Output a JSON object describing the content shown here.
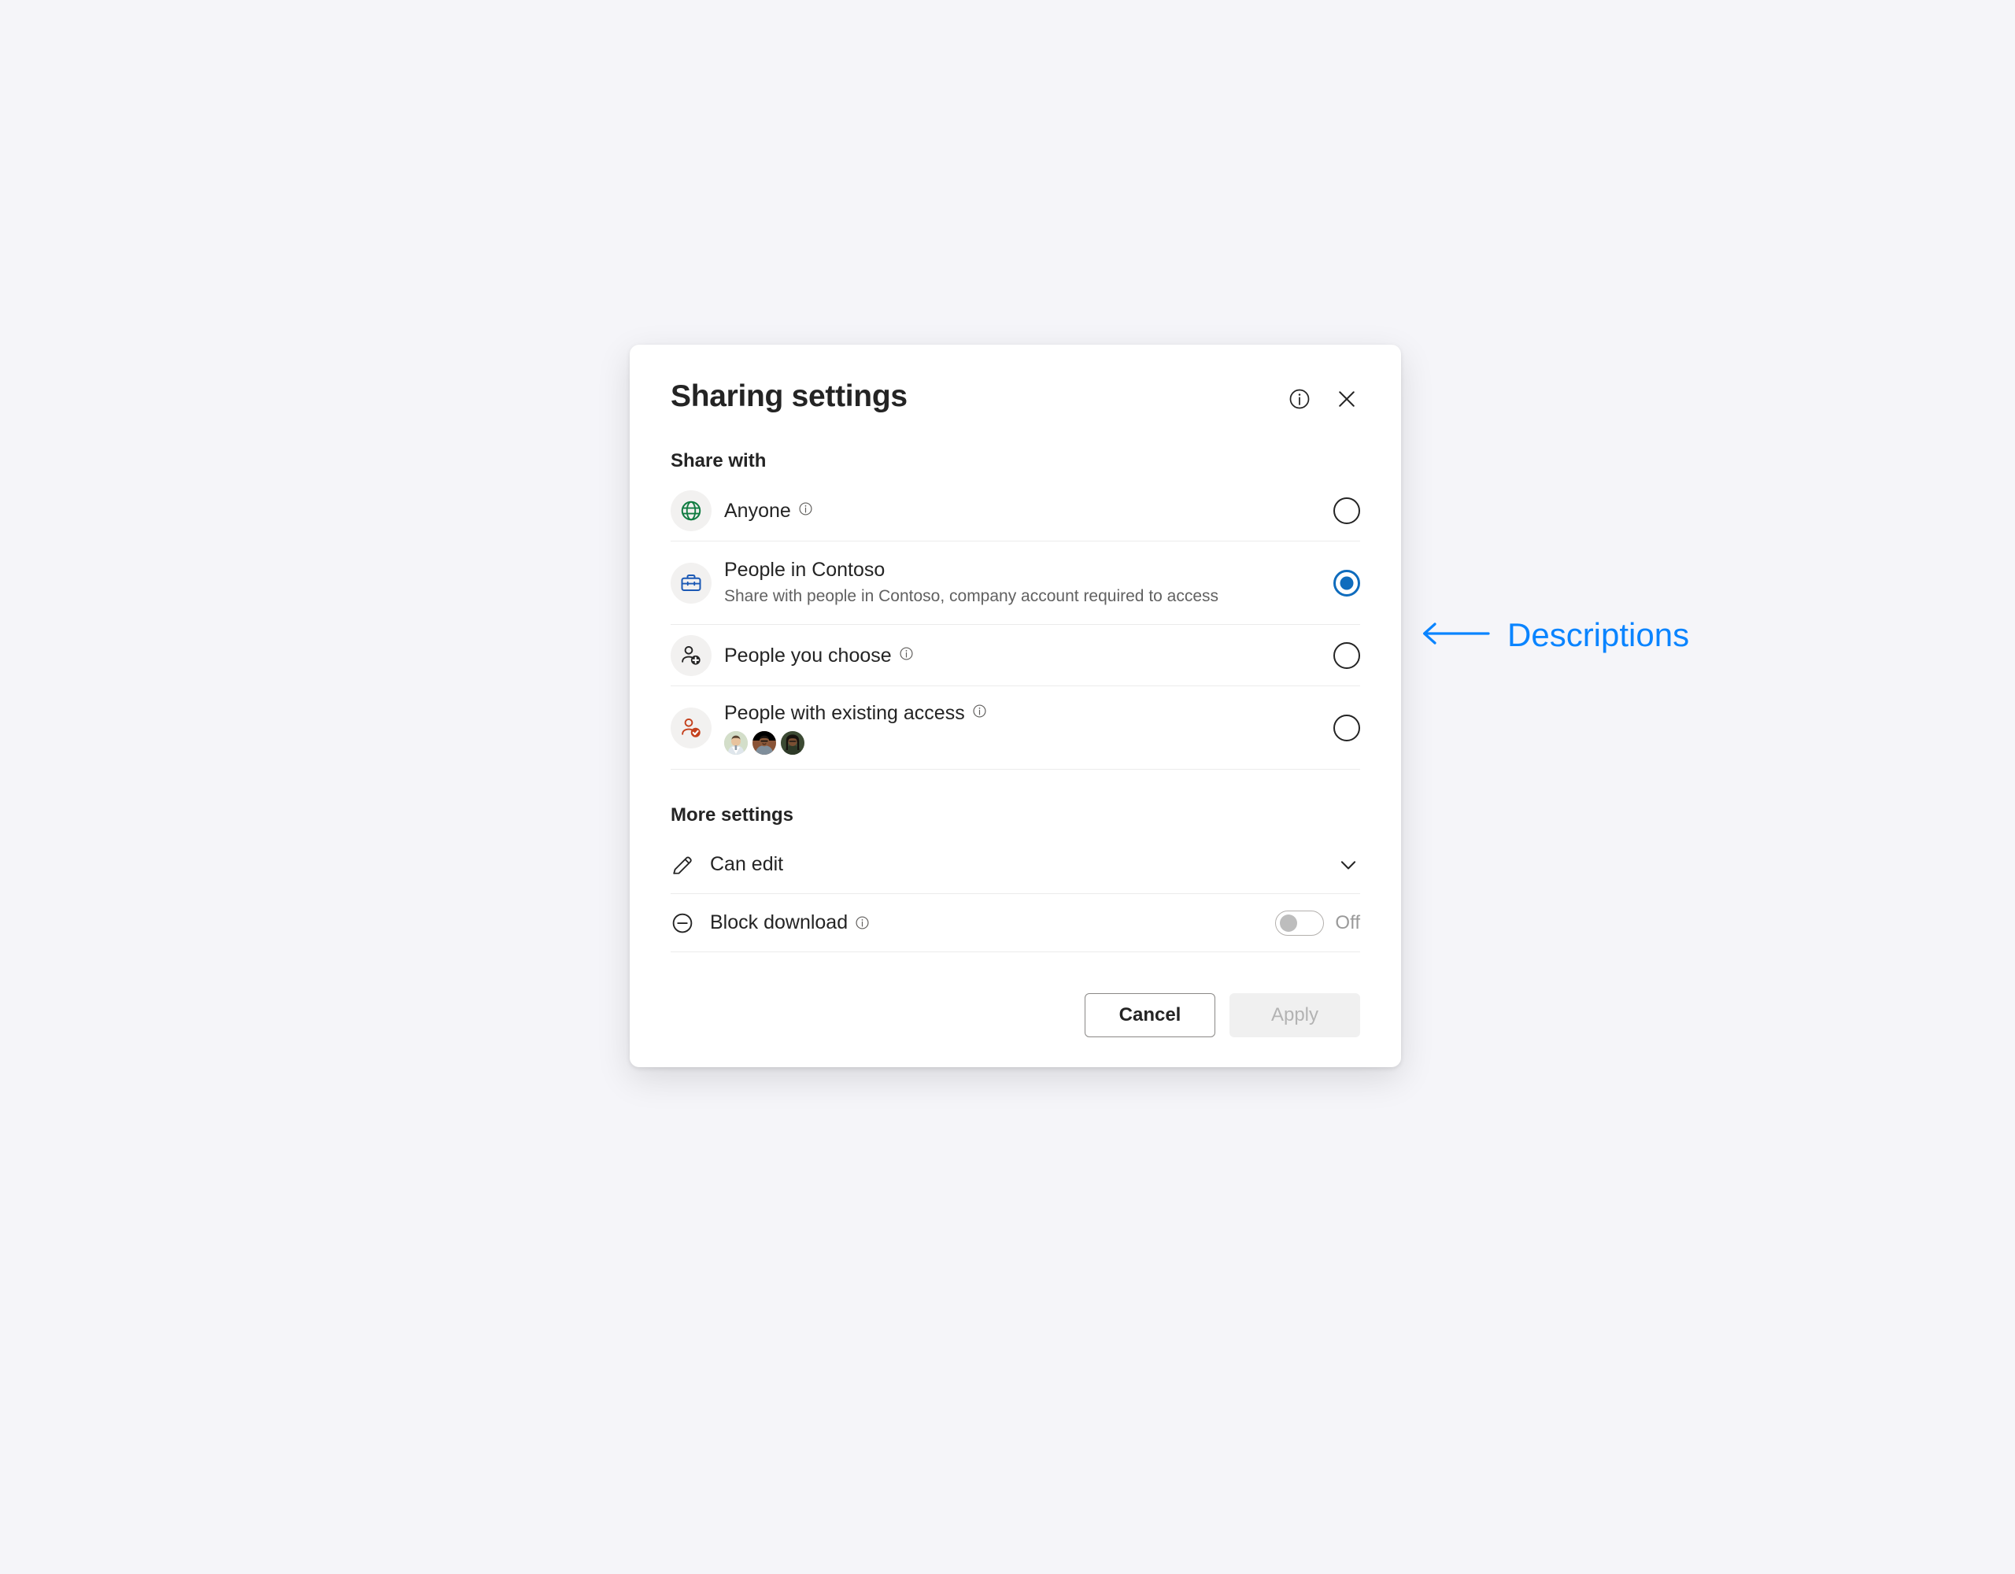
{
  "page": {
    "background_color": "#f5f5f9"
  },
  "dialog": {
    "title": "Sharing settings",
    "header_icons": {
      "info_label": "info-circle-icon",
      "close_label": "close-icon"
    },
    "share_with": {
      "section_label": "Share with",
      "options": [
        {
          "id": "anyone",
          "title": "Anyone",
          "description": "",
          "has_info": true,
          "icon": "globe-icon",
          "icon_color": "#107c41",
          "selected": false
        },
        {
          "id": "people-in-contoso",
          "title": "People in Contoso",
          "description": "Share with people in Contoso, company account required to access",
          "has_info": false,
          "icon": "briefcase-icon",
          "icon_color": "#1b59b5",
          "selected": true
        },
        {
          "id": "people-you-choose",
          "title": "People you choose",
          "description": "",
          "has_info": true,
          "icon": "person-add-icon",
          "icon_color": "#242424",
          "selected": false
        },
        {
          "id": "people-with-existing-access",
          "title": "People with existing access",
          "description": "",
          "has_info": true,
          "icon": "person-check-icon",
          "icon_color": "#c4401c",
          "selected": false,
          "avatars": [
            {
              "name": "avatar-person-1",
              "bg": "#cfd9c6",
              "skin": "#e8c39e",
              "hair": "#4b3a2a",
              "shirt": "#dfe6ec"
            },
            {
              "name": "avatar-person-2",
              "bg": "#8f5a3c",
              "skin": "#8d5a3b",
              "hair": "#1d1510",
              "shirt": "#7b8b99"
            },
            {
              "name": "avatar-person-3",
              "bg": "#3c4a33",
              "skin": "#7a4f33",
              "hair": "#15110d",
              "shirt": "#2e3a28"
            }
          ]
        }
      ]
    },
    "more_settings": {
      "section_label": "More settings",
      "permission": {
        "label": "Can edit",
        "icon": "pencil-icon",
        "chevron": "chevron-down-icon"
      },
      "block_download": {
        "label": "Block download",
        "icon": "minus-circle-icon",
        "has_info": true,
        "toggle_state": "Off",
        "toggle_on": false
      }
    },
    "footer": {
      "cancel_label": "Cancel",
      "apply_label": "Apply",
      "apply_disabled": true
    }
  },
  "annotation": {
    "text": "Descriptions",
    "color": "#0a84ff",
    "arrow": "arrow-left-icon"
  }
}
